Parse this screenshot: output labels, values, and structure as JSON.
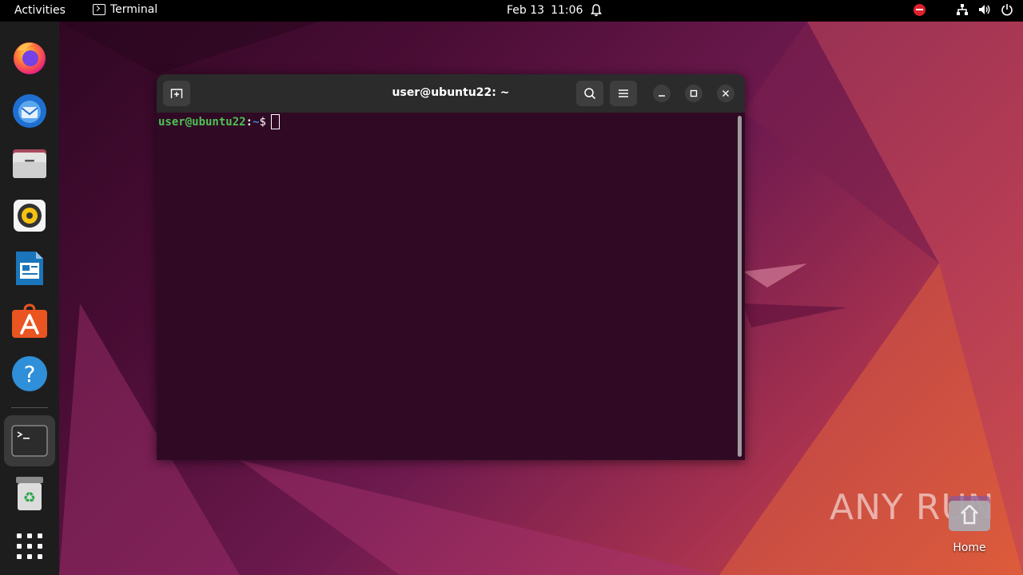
{
  "topbar": {
    "activities": "Activities",
    "app_name": "Terminal",
    "date": "Feb 13",
    "time": "11:06",
    "icons": [
      "terminal-icon",
      "bell-icon",
      "stop-icon",
      "network-icon",
      "volume-icon",
      "power-icon"
    ],
    "colors": {
      "background": "#000000",
      "stop": "#e0202b"
    }
  },
  "dock": {
    "items": [
      {
        "name": "firefox"
      },
      {
        "name": "thunderbird"
      },
      {
        "name": "files"
      },
      {
        "name": "rhythmbox"
      },
      {
        "name": "libreoffice-writer"
      },
      {
        "name": "app-center"
      },
      {
        "name": "help"
      },
      {
        "name": "terminal",
        "active": true
      },
      {
        "name": "trash"
      },
      {
        "name": "show-applications"
      }
    ],
    "running_indicator_color": "#e95420"
  },
  "terminal": {
    "title": "user@ubuntu22: ~",
    "prompt_user": "user@ubuntu22",
    "prompt_colon": ":",
    "prompt_path": "~",
    "prompt_symbol": "$",
    "colors": {
      "background": "#300a24",
      "header": "#2b2b2b",
      "user": "#4dc255",
      "path": "#3f82d9"
    }
  },
  "desktop": {
    "home_label": "Home",
    "watermark": "ANY RUN"
  }
}
